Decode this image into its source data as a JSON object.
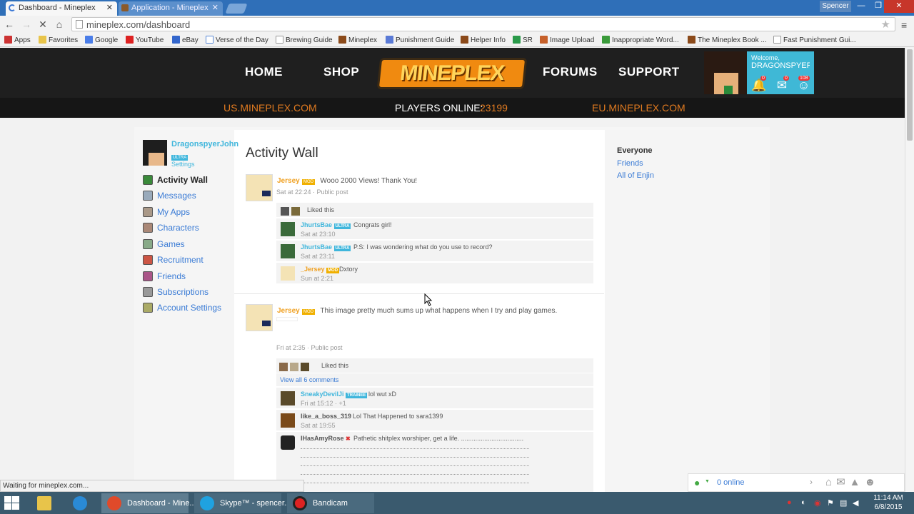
{
  "browser": {
    "tabs": [
      {
        "title": "Dashboard - Mineplex",
        "active": true
      },
      {
        "title": "Application - Mineplex",
        "active": false
      }
    ],
    "profile": "Spencer",
    "url": "mineplex.com/dashboard",
    "bookmarks": [
      "Apps",
      "Favorites",
      "Google",
      "YouTube",
      "eBay",
      "Verse of the Day",
      "Brewing Guide",
      "Mineplex",
      "Punishment Guide",
      "Helper Info",
      "SR",
      "Image Upload",
      "Inappropriate Word...",
      "The Mineplex Book ...",
      "Fast Punishment Gui..."
    ],
    "status": "Waiting for mineplex.com..."
  },
  "site": {
    "nav": {
      "home": "HOME",
      "shop": "SHOP",
      "logo": "MINEPLEX",
      "forums": "FORUMS",
      "support": "SUPPORT"
    },
    "welcome": {
      "label": "Welcome,",
      "name": "DRAGONSPYER...",
      "notif_count": "0",
      "msg_count": "0",
      "friend_count": "108"
    },
    "subnav": {
      "us": "US.MINEPLEX.COM",
      "players_label": "PLAYERS ONLINE:",
      "players_count": "23199",
      "eu": "EU.MINEPLEX.COM"
    }
  },
  "sidebar": {
    "username": "DragonspyerJohn",
    "rank": "ULTRA",
    "settings": "Settings",
    "items": [
      "Activity Wall",
      "Messages",
      "My Apps",
      "Characters",
      "Games",
      "Recruitment",
      "Friends",
      "Subscriptions",
      "Account Settings"
    ]
  },
  "wall": {
    "title": "Activity Wall",
    "posts": [
      {
        "author": "Jersey",
        "rank": "MOD",
        "text": "Wooo 2000 Views! Thank You!",
        "meta": "Sat at 22:24 · Public post",
        "liked": "Liked this",
        "comments": [
          {
            "author": "JhurtsBae",
            "rank": "ULTRA",
            "text": "Congrats girl!",
            "meta": "Sat at 23:10"
          },
          {
            "author": "JhurtsBae",
            "rank": "ULTRA",
            "text": "P.S: I was wondering what do you use to record?",
            "meta": "Sat at 23:11"
          },
          {
            "author": "_Jersey",
            "rank": "MOD",
            "text": "Dxtory",
            "meta": "Sun at 2:21"
          }
        ]
      },
      {
        "author": "Jersey",
        "rank": "MOD",
        "text": "This image pretty much sums up what happens when I try and play games.",
        "meta": "Fri at 2:35 · Public post",
        "liked": "Liked this",
        "view_all": "View all 6 comments",
        "comments": [
          {
            "author": "SneakyDevilJi",
            "rank": "TRAINEE",
            "text": "lol wut xD",
            "meta": "Fri at 15:12 · +1"
          },
          {
            "author": "like_a_boss_319",
            "rank": "",
            "text": "Lol That Happened to sara1399",
            "meta": "Sat at 19:55"
          },
          {
            "author": "IHasAmyRose",
            "rank": "",
            "text": "Pathetic shitplex worshiper, get a life. ...................................",
            "meta": ""
          }
        ]
      }
    ]
  },
  "filters": [
    "Everyone",
    "Friends",
    "All of Enjin"
  ],
  "chat": {
    "online": "0 online"
  },
  "taskbar": {
    "items": [
      "Dashboard - Mine...",
      "Skype™ - spencer...",
      "Bandicam"
    ],
    "time": "11:14 AM",
    "date": "6/8/2015"
  },
  "colors": {
    "accent_orange": "#f08a10",
    "link_blue": "#3a7bd5",
    "ultra_cyan": "#3fb6dc",
    "mod_gold": "#f0a020"
  }
}
